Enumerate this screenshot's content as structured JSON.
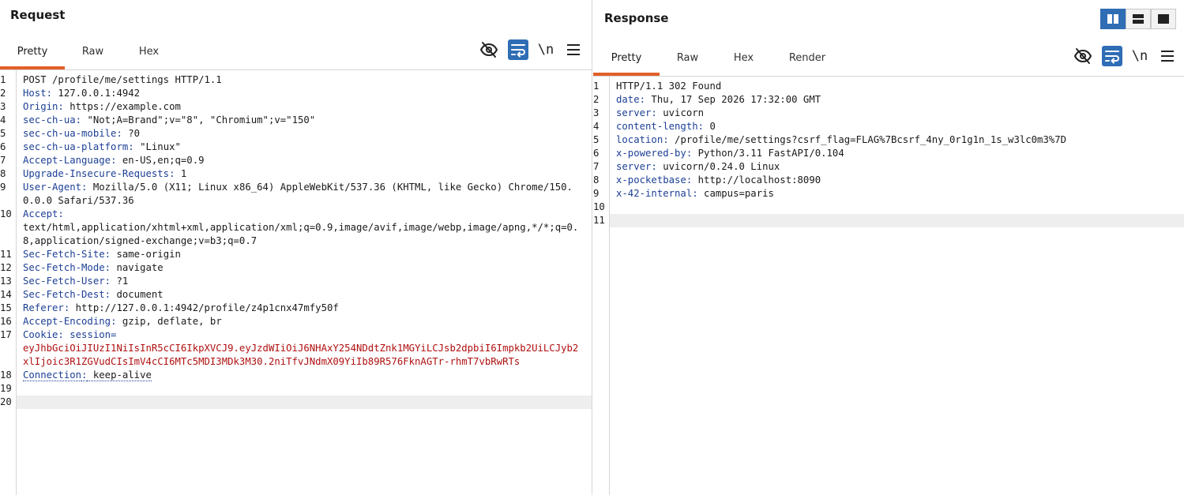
{
  "request": {
    "title": "Request",
    "tabs": [
      "Pretty",
      "Raw",
      "Hex"
    ],
    "active_tab": "Pretty",
    "toolbar": {
      "newline_label": "\\n"
    },
    "lines": [
      {
        "n": "1",
        "text": "POST /profile/me/settings HTTP/1.1"
      },
      {
        "n": "2",
        "name": "Host",
        "value": " 127.0.0.1:4942"
      },
      {
        "n": "3",
        "name": "Origin",
        "value": " https://example.com"
      },
      {
        "n": "4",
        "name": "sec-ch-ua",
        "value": " \"Not;A=Brand\";v=\"8\", \"Chromium\";v=\"150\""
      },
      {
        "n": "5",
        "name": "sec-ch-ua-mobile",
        "value": " ?0"
      },
      {
        "n": "6",
        "name": "sec-ch-ua-platform",
        "value": " \"Linux\""
      },
      {
        "n": "7",
        "name": "Accept-Language",
        "value": " en-US,en;q=0.9"
      },
      {
        "n": "8",
        "name": "Upgrade-Insecure-Requests",
        "value": " 1"
      },
      {
        "n": "9",
        "name": "User-Agent",
        "value": " Mozilla/5.0 (X11; Linux x86_64) AppleWebKit/537.36 (KHTML, like Gecko) Chrome/150.0.0.0 Safari/537.36"
      },
      {
        "n": "10",
        "name": "Accept",
        "value": "\ntext/html,application/xhtml+xml,application/xml;q=0.9,image/avif,image/webp,image/apng,*/*;q=0.8,application/signed-exchange;v=b3;q=0.7"
      },
      {
        "n": "11",
        "name": "Sec-Fetch-Site",
        "value": " same-origin"
      },
      {
        "n": "12",
        "name": "Sec-Fetch-Mode",
        "value": " navigate"
      },
      {
        "n": "13",
        "name": "Sec-Fetch-User",
        "value": " ?1"
      },
      {
        "n": "14",
        "name": "Sec-Fetch-Dest",
        "value": " document"
      },
      {
        "n": "15",
        "name": "Referer",
        "value": " http://127.0.0.1:4942/profile/z4p1cnx47mfy50f"
      },
      {
        "n": "16",
        "name": "Accept-Encoding",
        "value": " gzip, deflate, br"
      },
      {
        "n": "17",
        "name": "Cookie",
        "cookie_name": "session",
        "cookie_value": "eyJhbGciOiJIUzI1NiIsInR5cCI6IkpXVCJ9.eyJzdWIiOiJ6NHAxY254NDdtZnk1MGYiLCJsb2dpbiI6Impkb2UiLCJyb2xlIjoic3R1ZGVudCIsImV4cCI6MTc5MDI3MDk3M30.2niTfvJNdmX09YiIb89R576FknAGTr-rhmT7vbRwRTs"
      },
      {
        "n": "18",
        "name": "Connection",
        "value": " keep-alive",
        "dotted": true
      },
      {
        "n": "19",
        "text": ""
      },
      {
        "n": "20",
        "text": "",
        "current": true
      }
    ]
  },
  "response": {
    "title": "Response",
    "tabs": [
      "Pretty",
      "Raw",
      "Hex",
      "Render"
    ],
    "active_tab": "Pretty",
    "toolbar": {
      "newline_label": "\\n"
    },
    "lines": [
      {
        "n": "1",
        "text": "HTTP/1.1 302 Found"
      },
      {
        "n": "2",
        "name": "date",
        "value": " Thu, 17 Sep 2026 17:32:00 GMT"
      },
      {
        "n": "3",
        "name": "server",
        "value": " uvicorn"
      },
      {
        "n": "4",
        "name": "content-length",
        "value": " 0"
      },
      {
        "n": "5",
        "name": "location",
        "value": " /profile/me/settings?csrf_flag=FLAG%7Bcsrf_4ny_0r1g1n_1s_w3lc0m3%7D"
      },
      {
        "n": "6",
        "name": "x-powered-by",
        "value": " Python/3.11 FastAPI/0.104"
      },
      {
        "n": "7",
        "name": "server",
        "value": " uvicorn/0.24.0 Linux"
      },
      {
        "n": "8",
        "name": "x-pocketbase",
        "value": " http://localhost:8090"
      },
      {
        "n": "9",
        "name": "x-42-internal",
        "value": " campus=paris"
      },
      {
        "n": "10",
        "text": ""
      },
      {
        "n": "11",
        "text": "",
        "current": true
      }
    ]
  },
  "colors": {
    "accent": "#e2602a",
    "header_name": "#1c3f95",
    "cookie_value": "#b01010",
    "button_blue": "#2f6db5"
  },
  "icons": {
    "hide": "eye-off-icon",
    "wrap": "word-wrap-icon",
    "newline": "newline-icon",
    "menu": "hamburger-menu-icon",
    "layout": [
      "split-vertical-icon",
      "split-horizontal-icon",
      "single-pane-icon"
    ]
  }
}
